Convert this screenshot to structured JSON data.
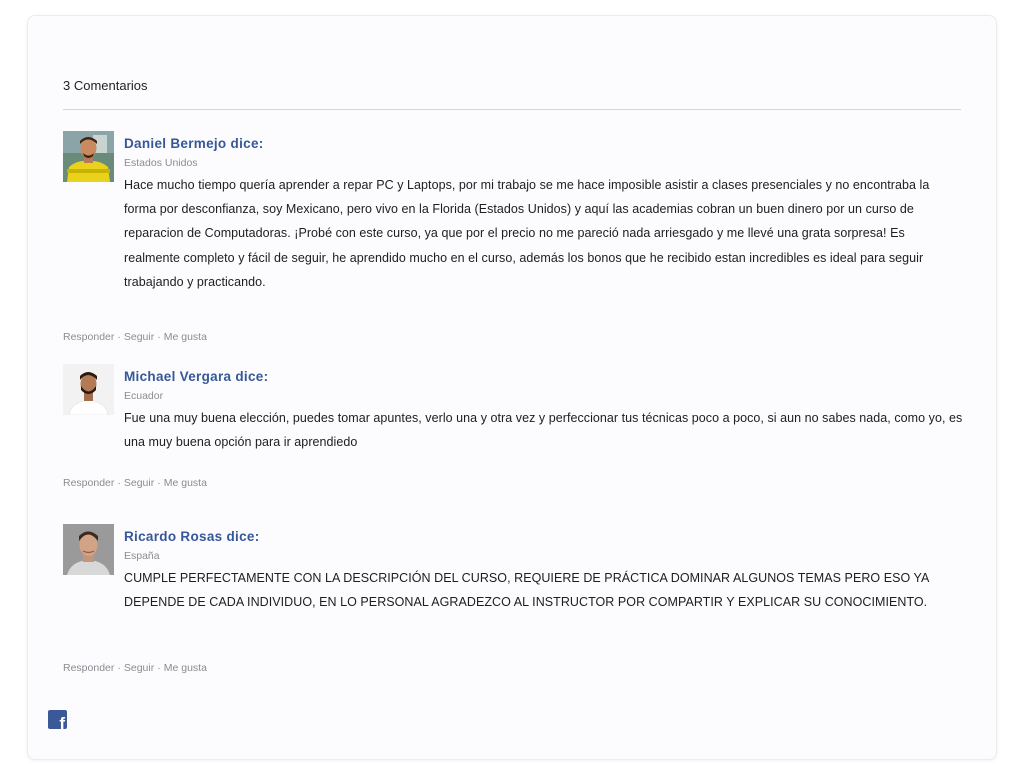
{
  "header": {
    "count_label": "3 Comentarios"
  },
  "comments": [
    {
      "author": "Daniel Bermejo dice:",
      "location": "Estados Unidos",
      "text": "Hace mucho tiempo quería aprender a repar PC y Laptops, por mi trabajo se me hace imposible asistir a clases presenciales y no encontraba la forma por desconfianza, soy Mexicano, pero vivo en la Florida (Estados Unidos) y aquí las academias cobran un buen dinero por un curso de reparacion de Computadoras. ¡Probé con este curso, ya que por el precio no me pareció nada arriesgado y me llevé una grata sorpresa! Es realmente completo y fácil de seguir, he aprendido mucho en el curso, además los bonos que he recibido estan incredibles es ideal para seguir trabajando y practicando.",
      "actions": {
        "reply": "Responder",
        "follow": "Seguir",
        "like": "Me gusta",
        "separator": "·"
      }
    },
    {
      "author": "Michael Vergara dice:",
      "location": "Ecuador",
      "text": "Fue una muy buena elección, puedes tomar apuntes, verlo una y otra vez y perfeccionar tus técnicas poco a poco, si aun no sabes nada, como yo, es una muy buena opción para ir aprendiedo",
      "actions": {
        "reply": "Responder",
        "follow": "Seguir",
        "like": "Me gusta",
        "separator": "·"
      }
    },
    {
      "author": "Ricardo Rosas dice:",
      "location": "España",
      "text": "CUMPLE PERFECTAMENTE CON LA DESCRIPCIÓN DEL CURSO, REQUIERE DE PRÁCTICA DOMINAR ALGUNOS TEMAS PERO ESO YA DEPENDE DE CADA INDIVIDUO, EN LO PERSONAL AGRADEZCO AL INSTRUCTOR POR COMPARTIR Y EXPLICAR SU CONOCIMIENTO.",
      "actions": {
        "reply": "Responder",
        "follow": "Seguir",
        "like": "Me gusta",
        "separator": "·"
      }
    }
  ],
  "footer": {
    "icon": "facebook-icon",
    "glyph": "f"
  },
  "colors": {
    "author_link": "#365899",
    "meta_gray": "#8a8d91",
    "facebook_blue": "#3b5998"
  }
}
